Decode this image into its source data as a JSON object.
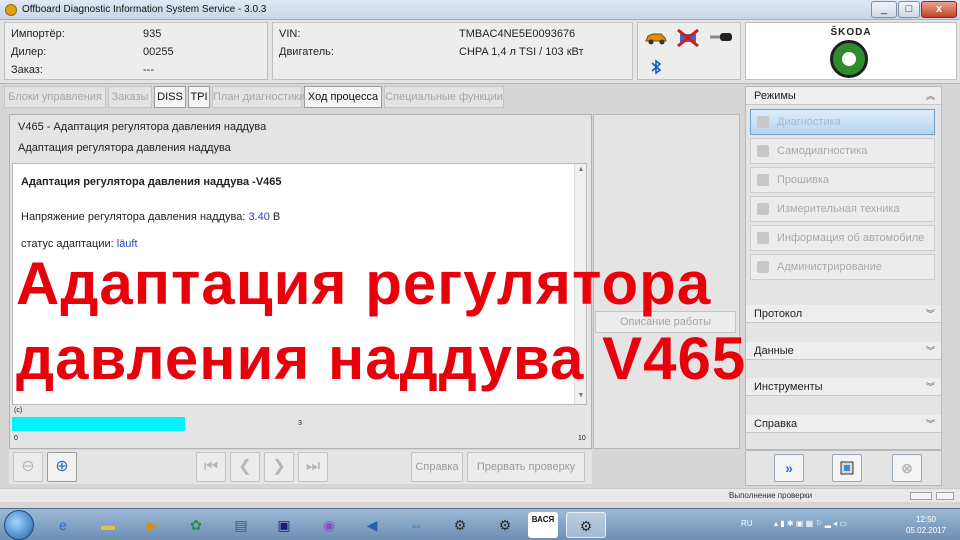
{
  "window": {
    "title": "Offboard Diagnostic Information System Service - 3.0.3",
    "minimize": "_",
    "maximize": "□",
    "close": "x"
  },
  "header": {
    "importer_label": "Импортёр:",
    "importer_value": "935",
    "dealer_label": "Дилер:",
    "dealer_value": "00255",
    "order_label": "Заказ:",
    "order_value": "---",
    "vin_label": "VIN:",
    "vin_value": "TMBAC4NE5E0093676",
    "engine_label": "Двигатель:",
    "engine_value": "CHPA 1,4 л TSI / 103 кВт",
    "brand": "ŠKODA",
    "status_icons": [
      "car-icon",
      "disconnected-vehicle-icon",
      "key-icon",
      "bluetooth-icon"
    ]
  },
  "tabs": [
    {
      "label": "Блоки управления",
      "active": false
    },
    {
      "label": "Заказы",
      "active": false
    },
    {
      "label": "DISS",
      "active": true
    },
    {
      "label": "TPI",
      "active": true
    },
    {
      "label": "План диагностики",
      "active": false
    },
    {
      "label": "Ход процесса",
      "active": true
    },
    {
      "label": "Специальные функции",
      "active": false
    }
  ],
  "main": {
    "breadcrumb1": "V465 - Адаптация регулятора давления наддува",
    "breadcrumb2": "Адаптация регулятора давления наддува",
    "content_title": "Адаптация регулятора давления наддува -V465",
    "voltage_label": "Напряжение регулятора давления наддува:",
    "voltage_value": "3.40",
    "voltage_unit": "В",
    "status_label": "статус адаптации:",
    "status_value": "läuft",
    "progress": {
      "header": "(c)",
      "value": 3,
      "min": 0,
      "max": 10,
      "value_label": "3",
      "min_label": "0",
      "max_label": "10",
      "bar_color": "#00f4ff"
    }
  },
  "overlay": {
    "line1": "Адаптация регулятора",
    "line2": "давления наддува V465",
    "color": "#e8000b"
  },
  "mid": {
    "description_button": "Описание работы"
  },
  "right": {
    "modes_header": "Режимы",
    "modes": [
      {
        "label": "Диагностика",
        "selected": true
      },
      {
        "label": "Самодиагностика",
        "selected": false
      },
      {
        "label": "Прошивка",
        "selected": false
      },
      {
        "label": "Измерительная техника",
        "selected": false
      },
      {
        "label": "Информация об автомобиле",
        "selected": false
      },
      {
        "label": "Администрирование",
        "selected": false
      }
    ],
    "protocol_header": "Протокол",
    "data_header": "Данные",
    "tools_header": "Инструменты",
    "help_header": "Справка"
  },
  "bottom": {
    "help_button": "Справка",
    "abort_button": "Прервать проверку",
    "next_icon": "»"
  },
  "status": {
    "text": "Выполнение проверки"
  },
  "taskbar": {
    "apps": [
      "ie-icon",
      "folder-icon",
      "media-icon",
      "network-icon",
      "tool-icon",
      "floppy-icon",
      "app-icon",
      "sound-icon",
      "teamviewer-icon",
      "engine-icon",
      "engine-icon",
      "vasya-icon",
      "engine-icon"
    ],
    "vasya_label": "ВАСЯ",
    "language": "RU",
    "time": "12:50",
    "date": "05.02.2017"
  }
}
